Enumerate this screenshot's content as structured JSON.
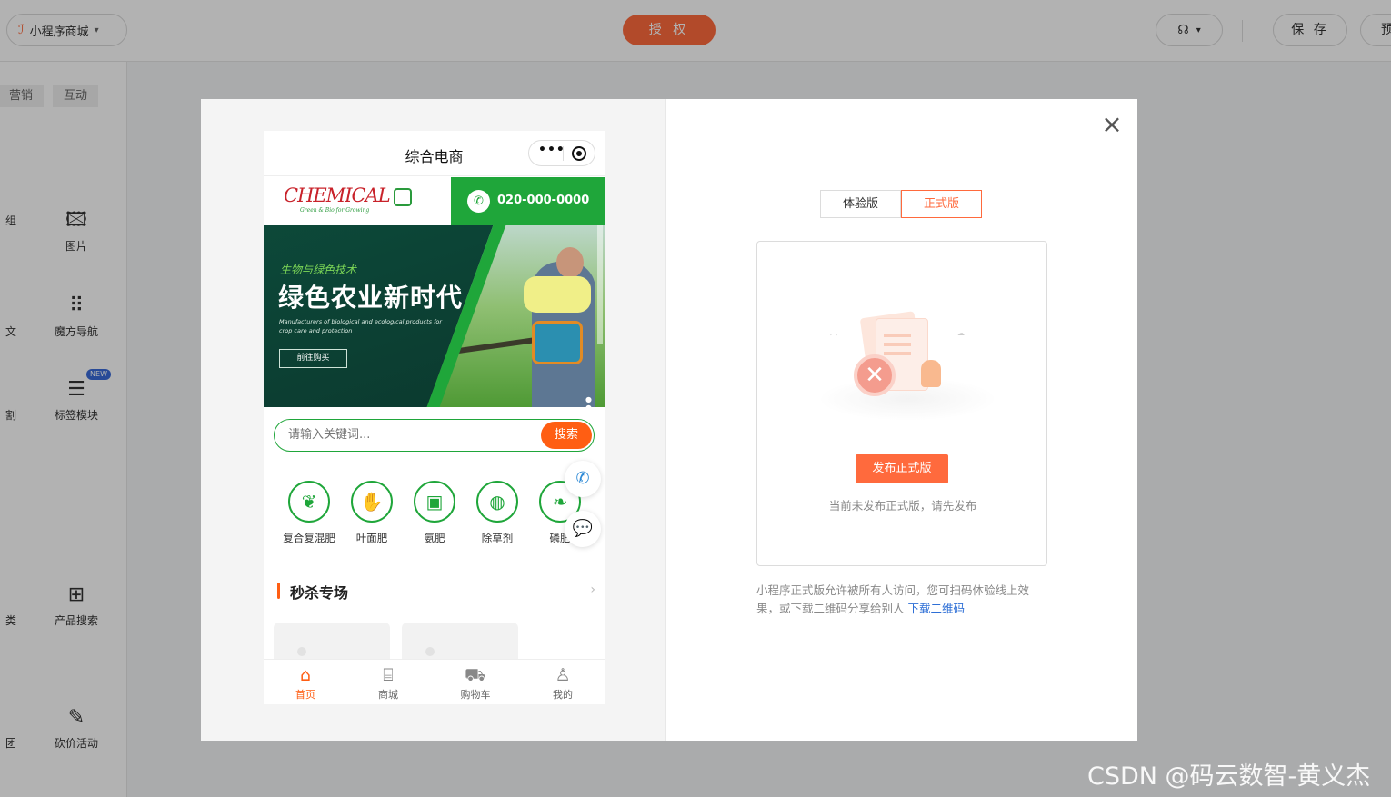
{
  "topbar": {
    "app_name": "小程序商城",
    "auth_label": "授 权",
    "save_label": "保 存",
    "preview_label": "预"
  },
  "sidebar": {
    "tabs": [
      "营销",
      "互动"
    ],
    "components": [
      {
        "label": "图片",
        "partial": "组"
      },
      {
        "label": "魔方导航",
        "partial": "文"
      },
      {
        "label": "标签模块",
        "partial": "割",
        "badge": "NEW"
      },
      {
        "label": "产品搜索",
        "partial": "类"
      },
      {
        "label": "砍价活动",
        "partial": "团"
      }
    ]
  },
  "phone": {
    "nav_title": "综合电商",
    "brand_name": "CHEMICAL",
    "brand_tagline": "Green & Bio for Growing",
    "phone_number": "020-000-0000",
    "banner": {
      "tag": "生物与绿色技术",
      "title": "绿色农业新时代",
      "desc": "Manufacturers of biological and ecological products for crop care and protection",
      "button": "前往购买"
    },
    "search_placeholder": "请输入关键词...",
    "search_button": "搜索",
    "categories": [
      "复合复混肥",
      "叶面肥",
      "氨肥",
      "除草剂",
      "磷肥"
    ],
    "seckill_title": "秒杀专场",
    "tabbar": [
      {
        "label": "首页",
        "icon": "home-icon"
      },
      {
        "label": "商城",
        "icon": "store-icon"
      },
      {
        "label": "购物车",
        "icon": "cart-icon"
      },
      {
        "label": "我的",
        "icon": "user-icon"
      }
    ]
  },
  "publish_panel": {
    "tab_trial": "体验版",
    "tab_official": "正式版",
    "publish_button": "发布正式版",
    "status_text": "当前未发布正式版，请先发布",
    "description": "小程序正式版允许被所有人访问，您可扫码体验线上效果，或下载二维码分享给别人",
    "download_link": "下载二维码"
  },
  "watermark": "CSDN @码云数智-黄义杰",
  "colors": {
    "accent": "#ff6a3d",
    "brand_green": "#1fa63a",
    "search_orange": "#ff5e13",
    "link": "#2e6fd6"
  }
}
